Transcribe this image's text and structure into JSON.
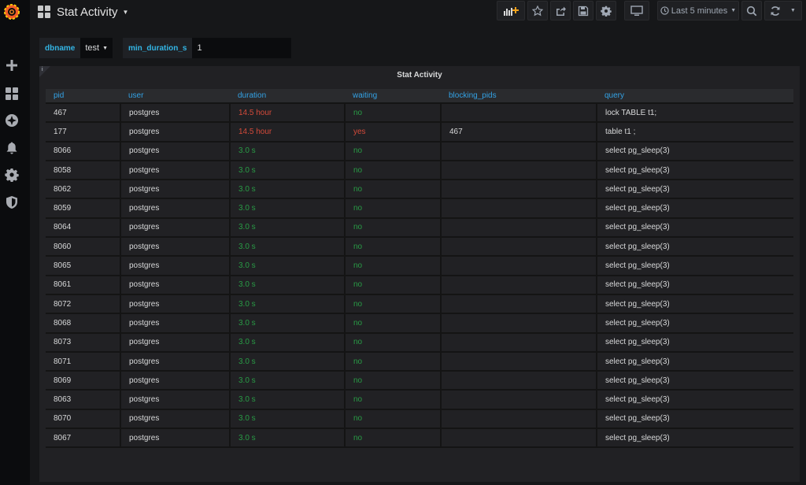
{
  "header": {
    "title": "Stat Activity",
    "buttons": {
      "add_panel": "add-panel",
      "star": "star",
      "share": "share",
      "save": "save",
      "settings": "settings",
      "tv_mode": "tv-mode",
      "time_range": "Last 5 minutes",
      "zoom_out": "zoom-out",
      "refresh": "refresh"
    }
  },
  "sidebar": {
    "items": [
      "create",
      "dashboards",
      "explore",
      "alerting",
      "configuration",
      "server-admin"
    ]
  },
  "variables": {
    "dbname": {
      "label": "dbname",
      "value": "test"
    },
    "min_duration": {
      "label": "min_duration_s",
      "value": "1"
    }
  },
  "panel": {
    "title": "Stat Activity",
    "info": "i",
    "columns": [
      "pid",
      "user",
      "duration",
      "waiting",
      "blocking_pids",
      "query"
    ],
    "rows": [
      {
        "pid": "467",
        "user": "postgres",
        "duration": "14.5 hour",
        "duration_status": "red",
        "waiting": "no",
        "waiting_status": "green",
        "blocking_pids": "",
        "query": "lock TABLE t1;"
      },
      {
        "pid": "177",
        "user": "postgres",
        "duration": "14.5 hour",
        "duration_status": "red",
        "waiting": "yes",
        "waiting_status": "red",
        "blocking_pids": "467",
        "query": "table t1 ;"
      },
      {
        "pid": "8066",
        "user": "postgres",
        "duration": "3.0 s",
        "duration_status": "green",
        "waiting": "no",
        "waiting_status": "green",
        "blocking_pids": "",
        "query": "select pg_sleep(3)"
      },
      {
        "pid": "8058",
        "user": "postgres",
        "duration": "3.0 s",
        "duration_status": "green",
        "waiting": "no",
        "waiting_status": "green",
        "blocking_pids": "",
        "query": "select pg_sleep(3)"
      },
      {
        "pid": "8062",
        "user": "postgres",
        "duration": "3.0 s",
        "duration_status": "green",
        "waiting": "no",
        "waiting_status": "green",
        "blocking_pids": "",
        "query": "select pg_sleep(3)"
      },
      {
        "pid": "8059",
        "user": "postgres",
        "duration": "3.0 s",
        "duration_status": "green",
        "waiting": "no",
        "waiting_status": "green",
        "blocking_pids": "",
        "query": "select pg_sleep(3)"
      },
      {
        "pid": "8064",
        "user": "postgres",
        "duration": "3.0 s",
        "duration_status": "green",
        "waiting": "no",
        "waiting_status": "green",
        "blocking_pids": "",
        "query": "select pg_sleep(3)"
      },
      {
        "pid": "8060",
        "user": "postgres",
        "duration": "3.0 s",
        "duration_status": "green",
        "waiting": "no",
        "waiting_status": "green",
        "blocking_pids": "",
        "query": "select pg_sleep(3)"
      },
      {
        "pid": "8065",
        "user": "postgres",
        "duration": "3.0 s",
        "duration_status": "green",
        "waiting": "no",
        "waiting_status": "green",
        "blocking_pids": "",
        "query": "select pg_sleep(3)"
      },
      {
        "pid": "8061",
        "user": "postgres",
        "duration": "3.0 s",
        "duration_status": "green",
        "waiting": "no",
        "waiting_status": "green",
        "blocking_pids": "",
        "query": "select pg_sleep(3)"
      },
      {
        "pid": "8072",
        "user": "postgres",
        "duration": "3.0 s",
        "duration_status": "green",
        "waiting": "no",
        "waiting_status": "green",
        "blocking_pids": "",
        "query": "select pg_sleep(3)"
      },
      {
        "pid": "8068",
        "user": "postgres",
        "duration": "3.0 s",
        "duration_status": "green",
        "waiting": "no",
        "waiting_status": "green",
        "blocking_pids": "",
        "query": "select pg_sleep(3)"
      },
      {
        "pid": "8073",
        "user": "postgres",
        "duration": "3.0 s",
        "duration_status": "green",
        "waiting": "no",
        "waiting_status": "green",
        "blocking_pids": "",
        "query": "select pg_sleep(3)"
      },
      {
        "pid": "8071",
        "user": "postgres",
        "duration": "3.0 s",
        "duration_status": "green",
        "waiting": "no",
        "waiting_status": "green",
        "blocking_pids": "",
        "query": "select pg_sleep(3)"
      },
      {
        "pid": "8069",
        "user": "postgres",
        "duration": "3.0 s",
        "duration_status": "green",
        "waiting": "no",
        "waiting_status": "green",
        "blocking_pids": "",
        "query": "select pg_sleep(3)"
      },
      {
        "pid": "8063",
        "user": "postgres",
        "duration": "3.0 s",
        "duration_status": "green",
        "waiting": "no",
        "waiting_status": "green",
        "blocking_pids": "",
        "query": "select pg_sleep(3)"
      },
      {
        "pid": "8070",
        "user": "postgres",
        "duration": "3.0 s",
        "duration_status": "green",
        "waiting": "no",
        "waiting_status": "green",
        "blocking_pids": "",
        "query": "select pg_sleep(3)"
      },
      {
        "pid": "8067",
        "user": "postgres",
        "duration": "3.0 s",
        "duration_status": "green",
        "waiting": "no",
        "waiting_status": "green",
        "blocking_pids": "",
        "query": "select pg_sleep(3)"
      }
    ]
  },
  "colors": {
    "red": "#d44a3a",
    "green": "#299c46",
    "accent": "#33b5e5",
    "header_text": "#33a2e5"
  }
}
